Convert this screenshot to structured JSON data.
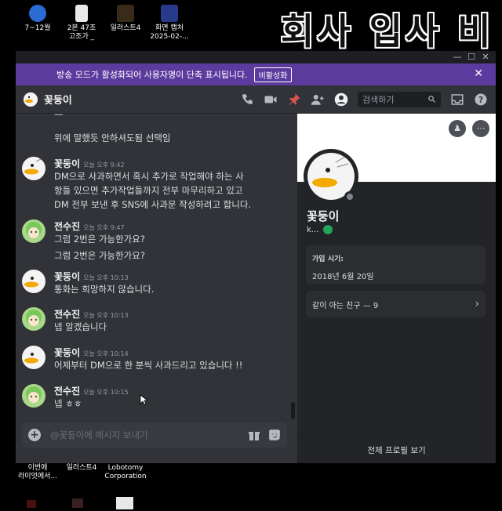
{
  "overlay_title": "회사 입사 비",
  "desktop": {
    "top_icons": [
      {
        "label1": "7~12월",
        "label2": ""
      },
      {
        "label1": "2본 47조",
        "label2": "고조가 _"
      },
      {
        "label1": "일러스트4",
        "label2": ""
      },
      {
        "label1": "화면 캡처",
        "label2": "2025-02-..."
      }
    ],
    "bottom_icons": [
      {
        "label1": "이번에",
        "label2": "라이엇에서..."
      },
      {
        "label1": "일러스트4",
        "label2": ""
      },
      {
        "label1": "Lobotomy",
        "label2": "Corporation"
      }
    ]
  },
  "window": {
    "controls": [
      "—",
      "☐",
      "✕"
    ]
  },
  "banner": {
    "text": "방송 모드가 활성화되어 사용자명이 단축 표시됩니다.",
    "button": "비활성화",
    "close": "✕"
  },
  "header": {
    "name": "꽃둥이",
    "search_placeholder": "검색하기"
  },
  "messages": {
    "partial_line": "위에 말했듯 안하셔도됨 선택임",
    "items": [
      {
        "author": "꽃둥이",
        "time": "오늘 오후 9:42",
        "lines": [
          "DM으로 사과하면서 혹시 추가로 작업해야 하는 사",
          "항들 있으면 추가작업들까지 전부 마무리하고 있고",
          "DM 전부 보낸 후 SNS에 사과문 작성하려고 합니다."
        ]
      },
      {
        "author": "전수진",
        "time": "오늘 오후 9:47",
        "lines": [
          "그럼 2번은 가능한가요?",
          "그럼 2번은 가능한가요?"
        ]
      },
      {
        "author": "꽃둥이",
        "time": "오늘 오후 10:13",
        "lines": [
          "통화는 희망하지 않습니다."
        ]
      },
      {
        "author": "전수진",
        "time": "오늘 오후 10:13",
        "lines": [
          "넵 알겠습니다"
        ]
      },
      {
        "author": "꽃둥이",
        "time": "오늘 오후 10:14",
        "lines": [
          "어제부터 DM으로 한 분씩 사과드리고 있습니다 !!"
        ]
      },
      {
        "author": "전수진",
        "time": "오늘 오후 10:15",
        "lines": [
          "넵 ㅎㅎ"
        ]
      }
    ]
  },
  "composer": {
    "placeholder": "@꽃둥이에 메시지 보내기"
  },
  "profile": {
    "name": "꽃둥이",
    "handle": "k...",
    "member_since_label": "가입 시기:",
    "member_since_value": "2018년 6월 20일",
    "mutual_friends": "같이 아는 친구 — 9",
    "full_profile": "전체 프로필 보기"
  },
  "colors": {
    "banner": "#5c3b9e",
    "background": "#313338",
    "sidebar": "#232428",
    "online_badge": "#23a55a"
  }
}
